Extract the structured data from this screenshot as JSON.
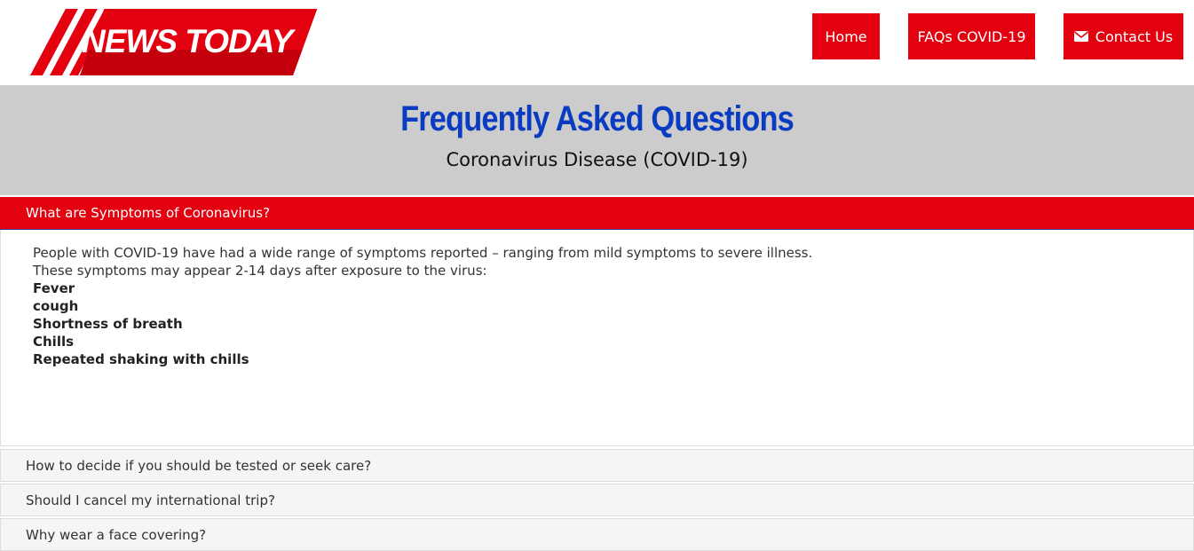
{
  "logo": {
    "text": "NEWS TODAY"
  },
  "nav": {
    "home": "Home",
    "faqs": "FAQs COVID-19",
    "contact": "Contact Us"
  },
  "banner": {
    "title": "Frequently Asked Questions",
    "subtitle": "Coronavirus Disease (COVID-19)"
  },
  "accordion": {
    "active": {
      "question": "What are Symptoms of Coronavirus?",
      "intro1": "People with COVID-19 have had a wide range of symptoms reported – ranging from mild symptoms to severe illness.",
      "intro2": "These symptoms may appear 2-14 days after exposure to the virus:",
      "symptoms": [
        "Fever",
        "cough",
        "Shortness of breath",
        "Chills",
        "Repeated shaking with chills"
      ]
    },
    "items": [
      {
        "question": "How to decide if you should be tested or seek care?"
      },
      {
        "question": "Should I cancel my international trip?"
      },
      {
        "question": "Why wear a face covering?"
      }
    ]
  },
  "colors": {
    "brand_red": "#e3000f",
    "title_blue": "#0a3cc2",
    "banner_gray": "#cccccc"
  },
  "icons": {
    "contact": "envelope-icon"
  }
}
